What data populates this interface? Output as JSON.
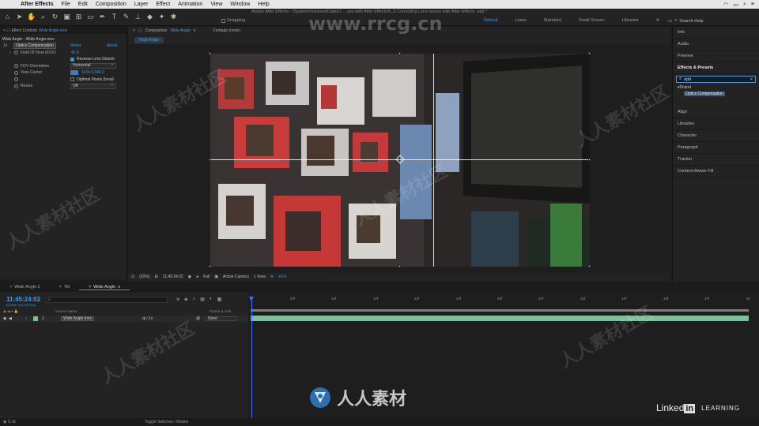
{
  "menubar": {
    "app": "After Effects",
    "items": [
      "File",
      "Edit",
      "Composition",
      "Layer",
      "Effect",
      "Animation",
      "View",
      "Window",
      "Help"
    ]
  },
  "toolbar": {
    "doc_title": "Adobe After Effects - /System/Volumes/Data/U ... ues with After Effects/6_6 Correcting Lens issues with After Effects .aep *",
    "snapping": "Snapping",
    "workspaces": [
      "Default",
      "Learn",
      "Standard",
      "Small Screen",
      "Libraries"
    ],
    "active_workspace": "Default",
    "search_help": "Search Help"
  },
  "effect_controls": {
    "tab_label": "Effect Controls",
    "tab_file": "Wide Angle.mov",
    "subtitle": "Wide Angle - Wide Angle.mov",
    "effect_name": "Optics Compensation",
    "reset": "Reset",
    "about": "About",
    "props": [
      {
        "label": "Field Of View (FOV)",
        "value": "41.8"
      },
      {
        "label": "",
        "checkbox": "Reverse Lens Distorti"
      },
      {
        "label": "FOV Orientation",
        "dropdown": "Horizontal"
      },
      {
        "label": "View Center",
        "value": "1134.0,344.0"
      },
      {
        "label": "",
        "checkbox": "Optimal Pixels (Invali"
      },
      {
        "label": "Resize",
        "dropdown": "Off"
      }
    ]
  },
  "composition": {
    "tab_label": "Composition",
    "tab_name": "Wide Angle",
    "footage_tab": "Footage (none)",
    "breadcrumb": "Wide Angle",
    "footer": {
      "zoom": "(50%)",
      "timecode": "11:45:24:02",
      "resolution": "Full",
      "camera": "Active Camera",
      "views": "1 View",
      "exposure": "+0.0"
    }
  },
  "right_panel": {
    "items_top": [
      "Info",
      "Audio",
      "Preview"
    ],
    "effects_presets": "Effects & Presets",
    "search_value": "opti",
    "category": "Distort",
    "result": "Optics Compensation",
    "items_bottom": [
      "Align",
      "Libraries",
      "Character",
      "Paragraph",
      "Tracker",
      "Content-Aware Fill"
    ]
  },
  "timeline": {
    "tabs": [
      "Wide Angle 2",
      "Tilt",
      "Wide Angle"
    ],
    "active_tab": "Wide Angle",
    "timecode": "11:45:24:02",
    "timecode_sub": "1234567 (23.976 fps)",
    "headers": {
      "source": "Source Name",
      "parent": "Parent & Link"
    },
    "layer": {
      "number": "1",
      "name": "Wide Angle.mov",
      "parent": "None"
    },
    "ruler": [
      "07f",
      "12f",
      "17f",
      "22f",
      "27f",
      "02f",
      "07f",
      "12f",
      "17f",
      "22f",
      "27f",
      "02"
    ],
    "footer_toggle": "Toggle Switches / Modes"
  },
  "overlays": {
    "site": "www.rrcg.cn",
    "watermark": "人人素材社区",
    "bottom_brand": "人人素材",
    "linkedin": "Linked",
    "linkedin_in": "in",
    "learning": "LEARNING"
  },
  "colors": {
    "accent": "#3a9cf0",
    "layer_bar": "#7dbf9d"
  }
}
